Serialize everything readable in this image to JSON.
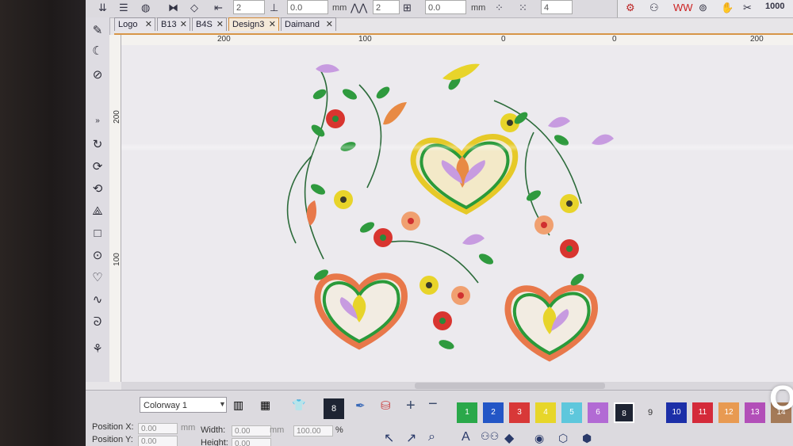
{
  "toolbar": {
    "field1": "2",
    "field2": "0.0",
    "unit1": "mm",
    "field3": "2",
    "field4": "0.0",
    "unit2": "mm",
    "field5": "4",
    "right_label": "1000"
  },
  "tabs": [
    {
      "label": "Logo"
    },
    {
      "label": "B13"
    },
    {
      "label": "B4S"
    },
    {
      "label": "Design3"
    },
    {
      "label": "Daimand"
    }
  ],
  "ruler_h": [
    "200",
    "100",
    "0",
    "0",
    "200"
  ],
  "ruler_v": [
    "200",
    "100"
  ],
  "bottom": {
    "colorway": "Colorway 1",
    "selected_color": "8",
    "colors": [
      {
        "n": "1",
        "hex": "#2aa84a"
      },
      {
        "n": "2",
        "hex": "#2356c6"
      },
      {
        "n": "3",
        "hex": "#d83838"
      },
      {
        "n": "4",
        "hex": "#e7d62a"
      },
      {
        "n": "5",
        "hex": "#5ec7dc"
      },
      {
        "n": "6",
        "hex": "#b26ad4"
      },
      {
        "n": "8",
        "hex": "#1e2433"
      },
      {
        "n": "9",
        "hex": "#dcdadf"
      },
      {
        "n": "10",
        "hex": "#1c2fa8"
      },
      {
        "n": "11",
        "hex": "#d42a3a"
      },
      {
        "n": "12",
        "hex": "#e89a52"
      },
      {
        "n": "13",
        "hex": "#b24fb8"
      },
      {
        "n": "14",
        "hex": "#a47a58"
      }
    ],
    "position_x_label": "Position X:",
    "position_y_label": "Position Y:",
    "position_x": "0.00",
    "position_y": "0.00",
    "unit": "mm",
    "width_label": "Width:",
    "height_label": "Height:",
    "width": "0.00",
    "height": "0.00",
    "scale": "100.00",
    "percent": "%"
  },
  "watermark": "OLX"
}
